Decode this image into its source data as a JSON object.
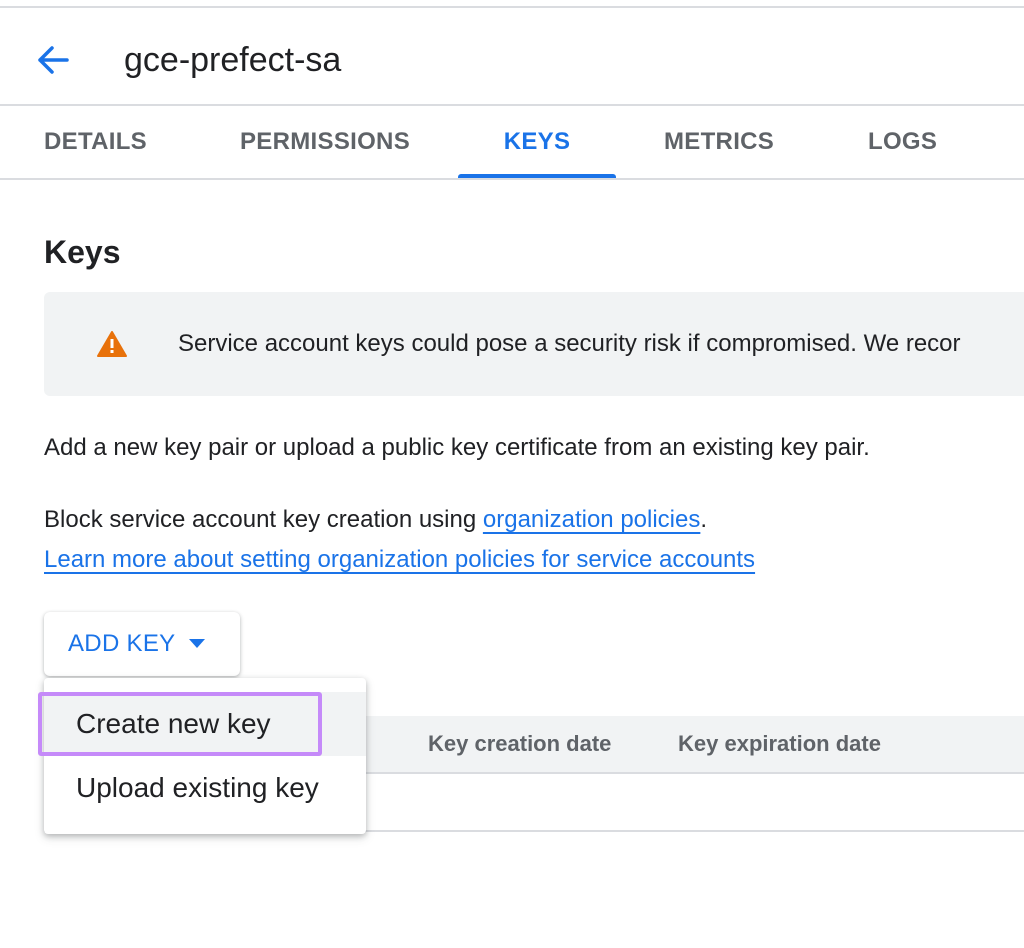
{
  "header": {
    "title": "gce-prefect-sa"
  },
  "tabs": [
    {
      "label": "DETAILS"
    },
    {
      "label": "PERMISSIONS"
    },
    {
      "label": "KEYS"
    },
    {
      "label": "METRICS"
    },
    {
      "label": "LOGS"
    }
  ],
  "active_tab": "KEYS",
  "section": {
    "title": "Keys"
  },
  "warning": {
    "text": "Service account keys could pose a security risk if compromised. We recor"
  },
  "description": {
    "line1": "Add a new key pair or upload a public key certificate from an existing key pair.",
    "line2_prefix": "Block service account key creation using ",
    "line2_link": "organization policies",
    "line2_suffix": ".",
    "line3_link": "Learn more about setting organization policies for service accounts"
  },
  "add_key": {
    "label": "ADD KEY"
  },
  "menu": {
    "items": [
      {
        "label": "Create new key"
      },
      {
        "label": "Upload existing key"
      }
    ]
  },
  "table": {
    "columns": [
      "Key creation date",
      "Key expiration date"
    ]
  },
  "colors": {
    "accent": "#1a73e8",
    "warning": "#e8710a",
    "highlight": "#c58af9"
  }
}
